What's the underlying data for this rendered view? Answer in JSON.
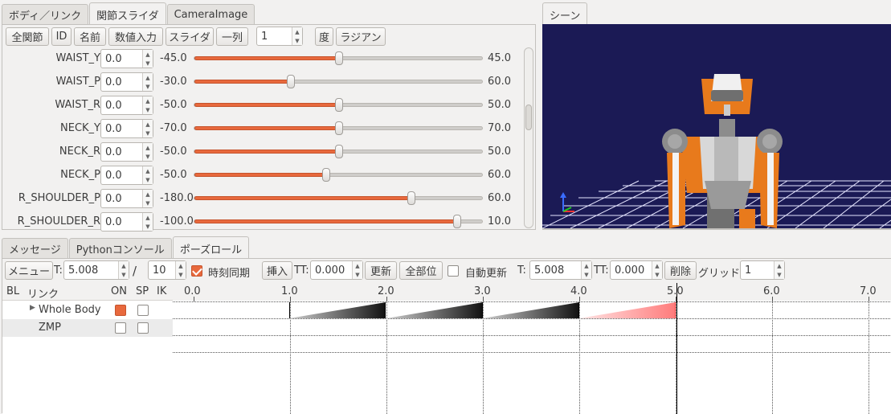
{
  "top_tabs": [
    "ボディ／リンク",
    "関節スライダ",
    "CameraImage"
  ],
  "scene_tab": "シーン",
  "toolbar": {
    "all_joints": "全関節",
    "id": "ID",
    "name": "名前",
    "numeric_input": "数値入力",
    "slider": "スライダ",
    "one_column": "一列",
    "column_count": "1",
    "degree": "度",
    "radian": "ラジアン"
  },
  "joints": [
    {
      "name": "WAIST_Y",
      "value": "0.0",
      "min": "-45.0",
      "max": "45.0",
      "pos": 0.5
    },
    {
      "name": "WAIST_P",
      "value": "0.0",
      "min": "-30.0",
      "max": "60.0",
      "pos": 0.333
    },
    {
      "name": "WAIST_R",
      "value": "0.0",
      "min": "-50.0",
      "max": "50.0",
      "pos": 0.5
    },
    {
      "name": "NECK_Y",
      "value": "0.0",
      "min": "-70.0",
      "max": "70.0",
      "pos": 0.5
    },
    {
      "name": "NECK_R",
      "value": "0.0",
      "min": "-50.0",
      "max": "50.0",
      "pos": 0.5
    },
    {
      "name": "NECK_P",
      "value": "0.0",
      "min": "-50.0",
      "max": "60.0",
      "pos": 0.455
    },
    {
      "name": "R_SHOULDER_P",
      "value": "0.0",
      "min": "-180.0",
      "max": "60.0",
      "pos": 0.75
    },
    {
      "name": "R_SHOULDER_R",
      "value": "0.0",
      "min": "-100.0",
      "max": "10.0",
      "pos": 0.909
    }
  ],
  "bottom_tabs": [
    "メッセージ",
    "Pythonコンソール",
    "ポーズロール"
  ],
  "pose_toolbar": {
    "menu": "メニュー",
    "t_label": "T:",
    "t_value": "5.008",
    "slash": "/",
    "t_total": "10",
    "time_sync_label": "時刻同期",
    "insert": "挿入",
    "tt_label": "TT:",
    "tt_value": "0.000",
    "update": "更新",
    "all_parts": "全部位",
    "auto_update_label": "自動更新",
    "t2_label": "T:",
    "t2_value": "5.008",
    "tt2_label": "TT:",
    "tt2_value": "0.000",
    "delete": "削除",
    "grid_label": "グリッド:",
    "grid_value": "1"
  },
  "link_table": {
    "headers": {
      "bl": "BL",
      "link": "リンク",
      "on": "ON",
      "sp": "SP",
      "ik": "IK"
    },
    "rows": [
      {
        "name": "Whole Body",
        "on": true,
        "sp": false
      },
      {
        "name": "ZMP",
        "on": false,
        "sp": false
      }
    ]
  },
  "timeline": {
    "ticks": [
      "0.0",
      "1.0",
      "2.0",
      "3.0",
      "4.0",
      "5.0",
      "6.0",
      "7.0"
    ],
    "current_time": 5.008
  },
  "colors": {
    "accent": "#e8693d",
    "scene_bg": "#1b1a55",
    "grid": "#e6e6ff",
    "robot_orange": "#e87a1c",
    "robot_gray": "#8c8c8c"
  }
}
